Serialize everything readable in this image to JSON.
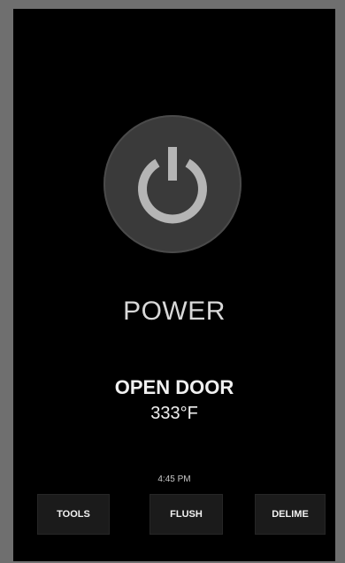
{
  "power": {
    "label": "POWER",
    "icon": "power-icon"
  },
  "status": {
    "title": "OPEN DOOR",
    "temperature": "333°F"
  },
  "clock": {
    "time": "4:45 PM"
  },
  "buttons": {
    "tools": "TOOLS",
    "flush": "FLUSH",
    "delime": "DELIME"
  },
  "colors": {
    "background": "#000000",
    "button": "#1b1b1b",
    "power_ring": "#3a3a3a",
    "power_glyph": "#b5b5b5",
    "text": "#f0f0f0"
  }
}
